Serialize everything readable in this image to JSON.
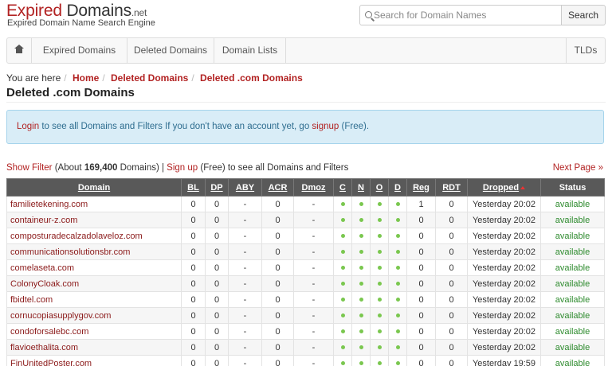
{
  "header": {
    "logo_main": "Expired",
    "logo_rest": " Domains",
    "logo_tld": ".net",
    "tagline": "Expired Domain Name Search Engine"
  },
  "search": {
    "placeholder": "Search for Domain Names",
    "button": "Search"
  },
  "nav": {
    "home_icon": "home-icon",
    "items": [
      "Expired Domains",
      "Deleted Domains",
      "Domain Lists"
    ],
    "right": "TLDs"
  },
  "breadcrumb": {
    "prefix": "You are here",
    "items": [
      "Home",
      "Deleted Domains",
      "Deleted .com Domains"
    ]
  },
  "page_title": "Deleted .com Domains",
  "alert": {
    "login": "Login",
    "middle": " to see all Domains and Filters If you don't have an account yet, go ",
    "signup": "signup",
    "end": " (Free)."
  },
  "filter": {
    "show_filter": "Show Filter",
    "about_prefix": " (About ",
    "count": "169,400",
    "about_suffix": " Domains) | ",
    "signup": "Sign up",
    "rest": " (Free) to see all Domains and Filters",
    "next_page": "Next Page »"
  },
  "table": {
    "columns": [
      "Domain",
      "BL",
      "DP",
      "ABY",
      "ACR",
      "Dmoz",
      "C",
      "N",
      "O",
      "D",
      "Reg",
      "RDT",
      "Dropped",
      "Status"
    ],
    "rows": [
      {
        "domain": "familietekening.com",
        "bl": "0",
        "dp": "0",
        "aby": "-",
        "acr": "0",
        "dmoz": "-",
        "reg": "1",
        "rdt": "0",
        "dropped": "Yesterday 20:02",
        "status": "available"
      },
      {
        "domain": "containeur-z.com",
        "bl": "0",
        "dp": "0",
        "aby": "-",
        "acr": "0",
        "dmoz": "-",
        "reg": "0",
        "rdt": "0",
        "dropped": "Yesterday 20:02",
        "status": "available"
      },
      {
        "domain": "composturadecalzadolaveloz.com",
        "bl": "0",
        "dp": "0",
        "aby": "-",
        "acr": "0",
        "dmoz": "-",
        "reg": "0",
        "rdt": "0",
        "dropped": "Yesterday 20:02",
        "status": "available"
      },
      {
        "domain": "communicationsolutionsbr.com",
        "bl": "0",
        "dp": "0",
        "aby": "-",
        "acr": "0",
        "dmoz": "-",
        "reg": "0",
        "rdt": "0",
        "dropped": "Yesterday 20:02",
        "status": "available"
      },
      {
        "domain": "comelaseta.com",
        "bl": "0",
        "dp": "0",
        "aby": "-",
        "acr": "0",
        "dmoz": "-",
        "reg": "0",
        "rdt": "0",
        "dropped": "Yesterday 20:02",
        "status": "available"
      },
      {
        "domain": "ColonyCloak.com",
        "bl": "0",
        "dp": "0",
        "aby": "-",
        "acr": "0",
        "dmoz": "-",
        "reg": "0",
        "rdt": "0",
        "dropped": "Yesterday 20:02",
        "status": "available"
      },
      {
        "domain": "fbidtel.com",
        "bl": "0",
        "dp": "0",
        "aby": "-",
        "acr": "0",
        "dmoz": "-",
        "reg": "0",
        "rdt": "0",
        "dropped": "Yesterday 20:02",
        "status": "available"
      },
      {
        "domain": "cornucopiasupplygov.com",
        "bl": "0",
        "dp": "0",
        "aby": "-",
        "acr": "0",
        "dmoz": "-",
        "reg": "0",
        "rdt": "0",
        "dropped": "Yesterday 20:02",
        "status": "available"
      },
      {
        "domain": "condoforsalebc.com",
        "bl": "0",
        "dp": "0",
        "aby": "-",
        "acr": "0",
        "dmoz": "-",
        "reg": "0",
        "rdt": "0",
        "dropped": "Yesterday 20:02",
        "status": "available"
      },
      {
        "domain": "flavioethalita.com",
        "bl": "0",
        "dp": "0",
        "aby": "-",
        "acr": "0",
        "dmoz": "-",
        "reg": "0",
        "rdt": "0",
        "dropped": "Yesterday 20:02",
        "status": "available"
      },
      {
        "domain": "FinUnitedPoster.com",
        "bl": "0",
        "dp": "0",
        "aby": "-",
        "acr": "0",
        "dmoz": "-",
        "reg": "0",
        "rdt": "0",
        "dropped": "Yesterday 19:59",
        "status": "available"
      }
    ]
  },
  "colors": {
    "brand_red": "#b22222",
    "header_gray": "#595959",
    "status_green": "#2e8b2e",
    "dot_green": "#7ac74f"
  }
}
